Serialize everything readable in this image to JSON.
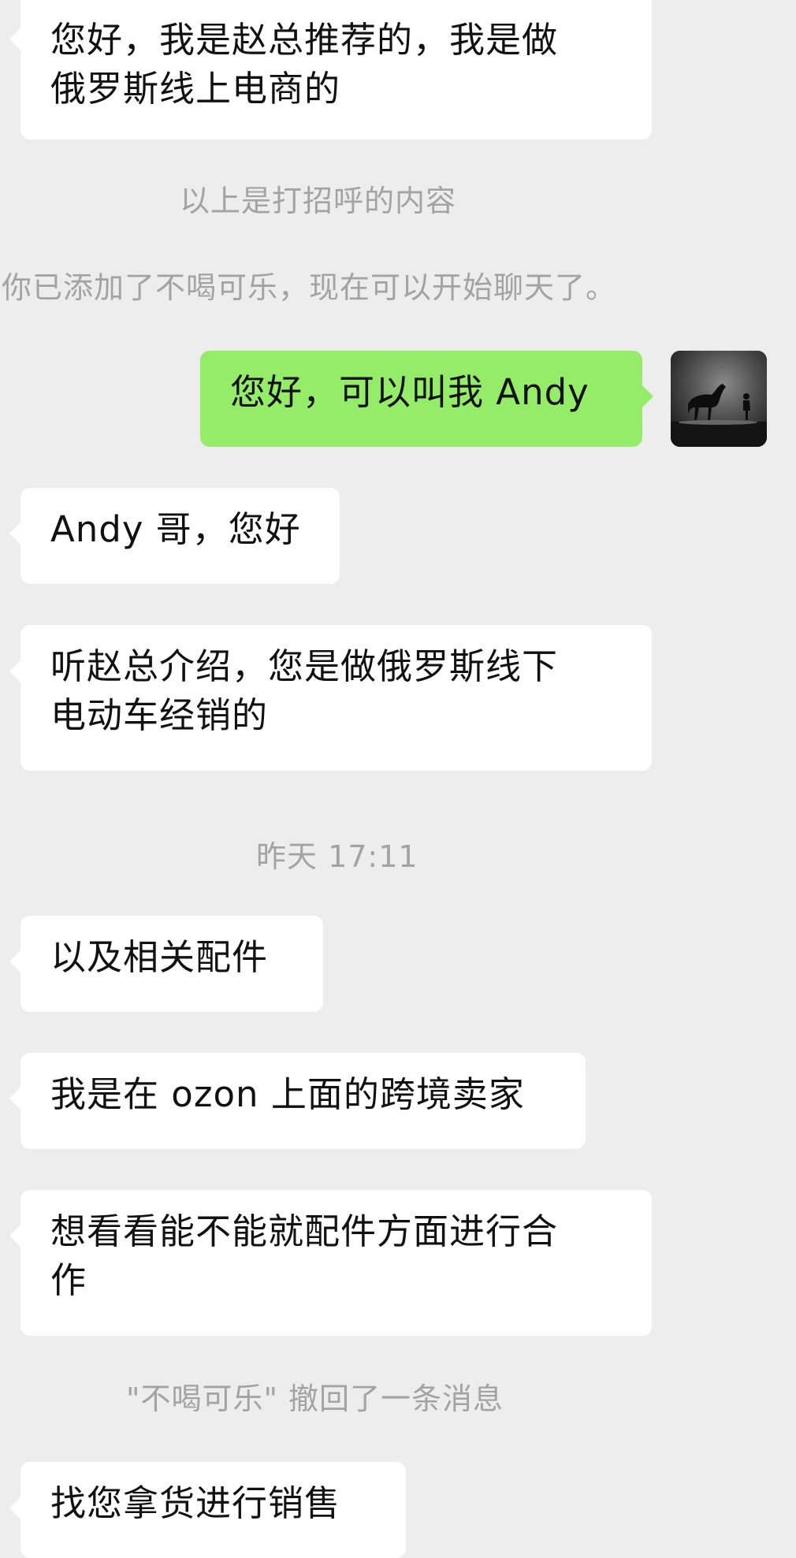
{
  "messages": [
    {
      "side": "in",
      "text_line1": "您好，我是赵总推荐的，我是做",
      "text_line2": "俄罗斯线上电商的"
    },
    {
      "side": "system",
      "text": "以上是打招呼的内容"
    },
    {
      "side": "system",
      "text": "你已添加了不喝可乐，现在可以开始聊天了。"
    },
    {
      "side": "out",
      "text": "您好，可以叫我 Andy"
    },
    {
      "side": "in",
      "text": "Andy 哥，您好"
    },
    {
      "side": "in",
      "text_line1": "听赵总介绍，您是做俄罗斯线下",
      "text_line2": "电动车经销的"
    },
    {
      "side": "time",
      "text": "昨天 17:11"
    },
    {
      "side": "in",
      "text": "以及相关配件"
    },
    {
      "side": "in",
      "text": "我是在 ozon 上面的跨境卖家"
    },
    {
      "side": "in",
      "text_line1": "想看看能不能就配件方面进行合",
      "text_line2": "作"
    },
    {
      "side": "system",
      "text": "\"不喝可乐\" 撤回了一条消息"
    },
    {
      "side": "in",
      "text": "找您拿货进行销售"
    }
  ],
  "avatar": {
    "icon": "horse-silhouette-avatar-icon"
  },
  "colors": {
    "background": "#ededed",
    "incoming_bubble": "#ffffff",
    "outgoing_bubble": "#95ec69",
    "system_text": "#a3a3a3"
  }
}
